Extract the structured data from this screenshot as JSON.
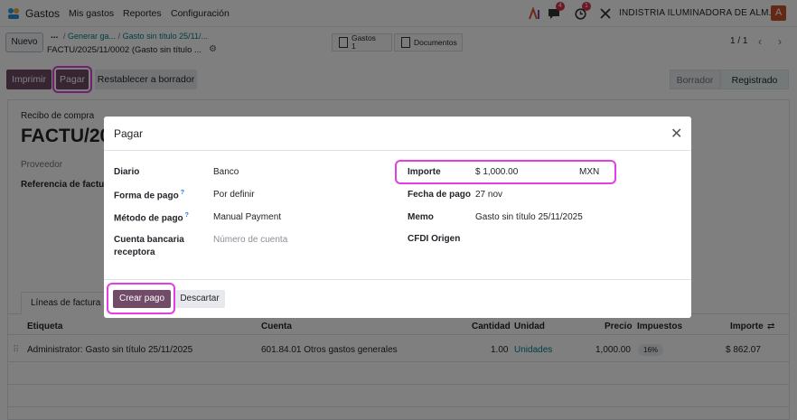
{
  "topbar": {
    "app_name": "Gastos",
    "menu": [
      "Mis gastos",
      "Reportes",
      "Configuración"
    ],
    "chat_badge": "4",
    "activity_badge": "1",
    "company": "INDISTRIA ILUMINADORA DE ALM...",
    "avatar_letter": "A"
  },
  "control": {
    "new_label": "Nuevo",
    "breadcrumb_dots": "...",
    "breadcrumb_parent1": "Generar ga...",
    "breadcrumb_parent2": "Gasto sin título 25/11/...",
    "record_title": "FACTU/2025/11/0002 (Gasto sin título ...",
    "smart_gastos_label": "Gastos",
    "smart_gastos_count": "1",
    "smart_docs_label": "Documentos",
    "pager": "1 / 1"
  },
  "actions": {
    "print": "Imprimir",
    "pay": "Pagar",
    "reset": "Restablecer a borrador",
    "status_draft": "Borrador",
    "status_posted": "Registrado"
  },
  "form": {
    "doc_type": "Recibo de compra",
    "name_visible": "FACTU/20",
    "vendor_label": "Proveedor",
    "ref_label": "Referencia de factura",
    "tab_lines": "Líneas de factura"
  },
  "lines": {
    "headers": [
      "Etiqueta",
      "Cuenta",
      "Cantidad",
      "Unidad",
      "Precio",
      "Impuestos",
      "Importe"
    ],
    "rows": [
      {
        "label": "Administrator: Gasto sin título 25/11/2025",
        "account": "601.84.01 Otros gastos generales",
        "qty": "1.00",
        "uom": "Unidades",
        "price": "1,000.00",
        "tax": "16%",
        "amount": "$ 862.07"
      }
    ]
  },
  "modal": {
    "title": "Pagar",
    "journal_label": "Diario",
    "journal_value": "Banco",
    "payment_form_label": "Forma de pago",
    "payment_form_help": "?",
    "payment_form_value": "Por definir",
    "payment_method_label": "Método de pago",
    "payment_method_help": "?",
    "payment_method_value": "Manual Payment",
    "bank_account_label_1": "Cuenta bancaria",
    "bank_account_label_2": "receptora",
    "bank_account_placeholder": "Número de cuenta",
    "amount_label": "Importe",
    "amount_value": "$ 1,000.00",
    "currency": "MXN",
    "date_label": "Fecha de pago",
    "date_value": "27 nov",
    "memo_label": "Memo",
    "memo_value": "Gasto sin título 25/11/2025",
    "cfdi_label": "CFDI Origen",
    "create_button": "Crear pago",
    "discard_button": "Descartar"
  },
  "colors": {
    "primary": "#714b67",
    "link": "#017e84",
    "highlight": "#e33ee3"
  }
}
